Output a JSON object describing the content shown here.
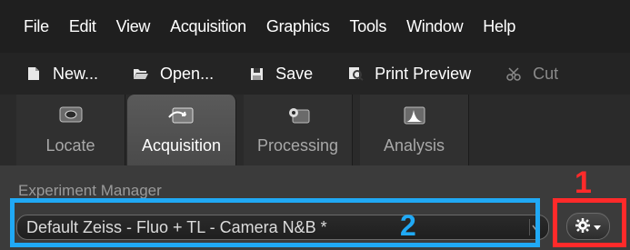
{
  "menubar": {
    "items": [
      "File",
      "Edit",
      "View",
      "Acquisition",
      "Graphics",
      "Tools",
      "Window",
      "Help"
    ]
  },
  "toolbar": {
    "new_label": "New...",
    "open_label": "Open...",
    "save_label": "Save",
    "print_preview_label": "Print Preview",
    "cut_label": "Cut"
  },
  "tabs": [
    {
      "label": "Locate",
      "icon": "locate-icon",
      "active": false
    },
    {
      "label": "Acquisition",
      "icon": "acquisition-icon",
      "active": true
    },
    {
      "label": "Processing",
      "icon": "processing-icon",
      "active": false
    },
    {
      "label": "Analysis",
      "icon": "analysis-icon",
      "active": false
    }
  ],
  "experiment_manager": {
    "title": "Experiment Manager",
    "selected_experiment": "Default Zeiss - Fluo + TL - Camera N&B *"
  },
  "annotations": {
    "label_1": "1",
    "label_2": "2",
    "color_1": "#ff2a2a",
    "color_2": "#20a9f5"
  }
}
